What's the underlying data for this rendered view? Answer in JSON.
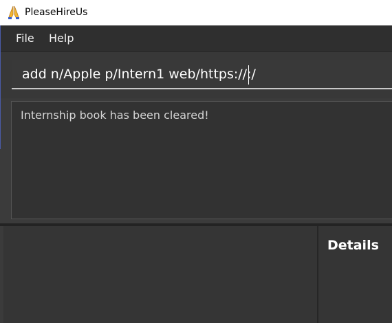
{
  "window": {
    "title": "PleaseHireUs",
    "icon": "praying-hands-icon"
  },
  "menu": {
    "items": [
      {
        "label": "File"
      },
      {
        "label": "Help"
      }
    ]
  },
  "command": {
    "value": "add n/Apple p/Intern1 web/https://:/"
  },
  "result": {
    "message": "Internship book has been cleared!"
  },
  "details": {
    "title": "Details"
  },
  "colors": {
    "background": "#3b3b3b",
    "menubar": "#2f2f2f",
    "text": "#ffffff"
  }
}
